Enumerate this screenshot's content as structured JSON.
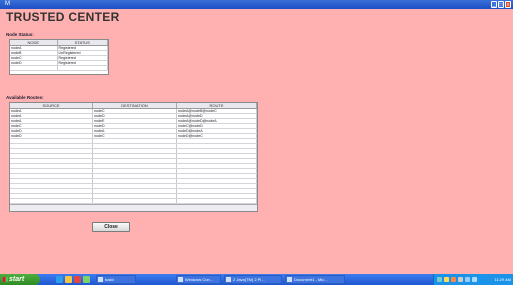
{
  "window": {
    "title": "M",
    "minimize": "_",
    "maximize": "□",
    "close": "x"
  },
  "app": {
    "title": "TRUSTED CENTER",
    "node_status_label": "Node Status:",
    "available_routes_label": "Available Routes:",
    "close_label": "Close"
  },
  "node_table": {
    "headers": [
      "NODE",
      "STATUS"
    ],
    "rows": [
      [
        "nodeA",
        "Registered"
      ],
      [
        "nodeB",
        "UnRegistered"
      ],
      [
        "nodeC",
        "Registered"
      ],
      [
        "nodeD",
        "Registered"
      ]
    ]
  },
  "routes_table": {
    "headers": [
      "SOURCE",
      "DESTINATION",
      "ROUTE"
    ],
    "rows": [
      [
        "nodeA",
        "nodeC",
        "nodeA@nodeB@nodeC"
      ],
      [
        "nodeA",
        "nodeD",
        "nodeA@nodeD"
      ],
      [
        "nodeA",
        "nodeE",
        "nodeA@nodeD@nodeA"
      ],
      [
        "nodeC",
        "nodeD",
        "nodeC@nodeD"
      ],
      [
        "nodeD",
        "nodeA",
        "nodeD@nodeA"
      ],
      [
        "nodeD",
        "nodeC",
        "nodeD@nodeC"
      ]
    ]
  },
  "taskbar": {
    "start_label": "start",
    "tasks": [
      {
        "label": "tustd"
      },
      {
        "label": "Windows Con..."
      },
      {
        "label": "2 Java(TM) 2 Pl..."
      },
      {
        "label": "Document1 - Mic..."
      }
    ],
    "clock": "11:29 AM"
  }
}
